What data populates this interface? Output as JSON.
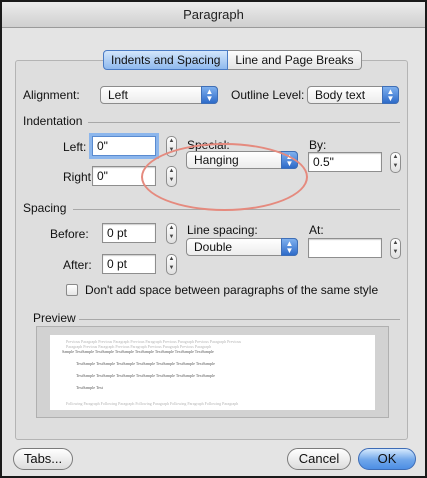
{
  "window": {
    "title": "Paragraph"
  },
  "tabs": [
    {
      "label": "Indents and Spacing",
      "active": true
    },
    {
      "label": "Line and Page Breaks",
      "active": false
    }
  ],
  "general": {
    "alignment_label": "Alignment:",
    "alignment_value": "Left",
    "outline_label": "Outline Level:",
    "outline_value": "Body text"
  },
  "indentation": {
    "title": "Indentation",
    "left_label": "Left:",
    "left_value": "0\"",
    "right_label": "Right:",
    "right_value": "0\"",
    "special_label": "Special:",
    "special_value": "Hanging",
    "by_label": "By:",
    "by_value": "0.5\""
  },
  "spacing": {
    "title": "Spacing",
    "before_label": "Before:",
    "before_value": "0 pt",
    "after_label": "After:",
    "after_value": "0 pt",
    "line_spacing_label": "Line spacing:",
    "line_spacing_value": "Double",
    "at_label": "At:",
    "at_value": ""
  },
  "checkbox": {
    "label": "Don't add space between paragraphs of the same style",
    "checked": false
  },
  "preview": {
    "title": "Preview",
    "prev_lines": [
      "Previous Paragraph Previous Paragraph Previous Paragraph Previous Paragraph Previous Paragraph Previous",
      "Paragraph Previous Paragraph Previous Paragraph Previous Paragraph Previous Paragraph"
    ],
    "sample_lines": [
      "Sample TextSample TextSample TextSample TextSample TextSample TextSample TextSample",
      "TextSample TextSample TextSample TextSample TextSample TextSample TextSample",
      "TextSample TextSample TextSample TextSample TextSample TextSample TextSample",
      "TextSample Text"
    ],
    "next_line": "Following Paragraph Following Paragraph Following Paragraph Following Paragraph Following Paragraph"
  },
  "buttons": {
    "tabs": "Tabs...",
    "cancel": "Cancel",
    "ok": "OK"
  },
  "colors": {
    "accent": "#4d8ee4",
    "highlight_ellipse": "#e58a7e",
    "panel": "#dedede"
  },
  "icons": {
    "stepper": "stepper-icon",
    "popup": "popup-arrows-icon"
  }
}
